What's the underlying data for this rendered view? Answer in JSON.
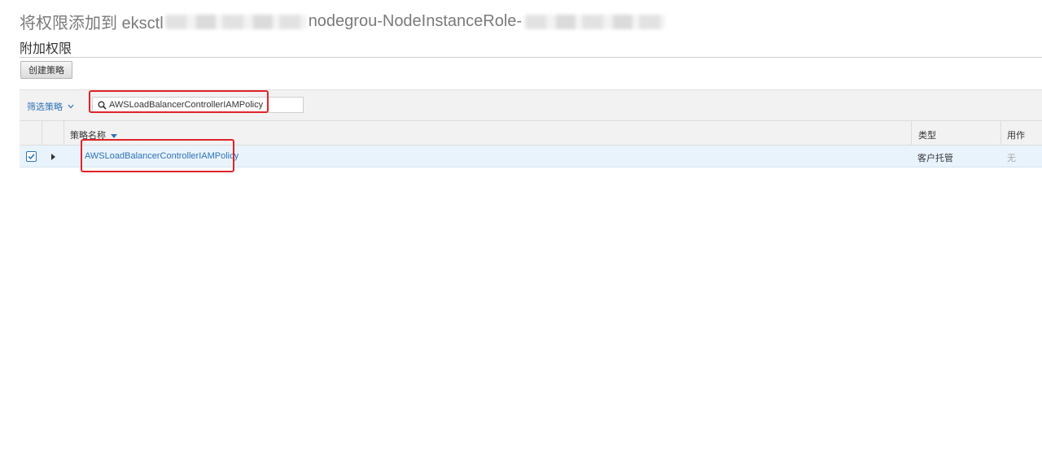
{
  "header": {
    "title_prefix": "将权限添加到 eksctl",
    "title_middle": "nodegrou-NodeInstanceRole-",
    "subtitle": "附加权限"
  },
  "toolbar": {
    "create_policy_label": "创建策略"
  },
  "filter": {
    "dropdown_label": "筛选策略",
    "search_value": "AWSLoadBalancerControllerIAMPolicy"
  },
  "table": {
    "columns": {
      "name": "策略名称",
      "type": "类型",
      "usage": "用作"
    },
    "rows": [
      {
        "checked": true,
        "name": "AWSLoadBalancerControllerIAMPolicy",
        "type": "客户托管",
        "usage": "无"
      }
    ]
  },
  "colors": {
    "link": "#2e73b8",
    "highlight": "#e0242a",
    "selected_row": "#e9f3fc"
  },
  "icons": [
    "search-icon",
    "chevron-down-icon",
    "sort-down-icon",
    "check-icon",
    "expand-right-icon"
  ]
}
